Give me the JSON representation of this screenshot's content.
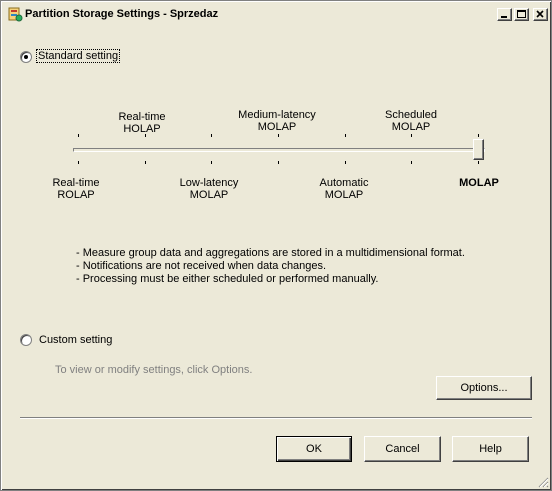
{
  "window": {
    "title": "Partition Storage Settings - Sprzedaz"
  },
  "standard": {
    "label": "Standard setting",
    "selected": true,
    "selected_level": "MOLAP",
    "levels_top": [
      {
        "line1": "Real-time",
        "line2": "HOLAP"
      },
      {
        "line1": "Medium-latency",
        "line2": "MOLAP"
      },
      {
        "line1": "Scheduled",
        "line2": "MOLAP"
      }
    ],
    "levels_bottom": [
      {
        "line1": "Real-time",
        "line2": "ROLAP"
      },
      {
        "line1": "Low-latency",
        "line2": "MOLAP"
      },
      {
        "line1": "Automatic",
        "line2": "MOLAP"
      },
      {
        "line1": "MOLAP",
        "line2": ""
      }
    ],
    "description": [
      "- Measure group data and aggregations are stored in a multidimensional format.",
      "- Notifications are not received when data changes.",
      "- Processing must be either scheduled or performed manually."
    ]
  },
  "custom": {
    "label": "Custom setting",
    "selected": false,
    "hint": "To view or modify settings, click Options.",
    "options_button": "Options..."
  },
  "footer": {
    "ok": "OK",
    "cancel": "Cancel",
    "help": "Help"
  }
}
